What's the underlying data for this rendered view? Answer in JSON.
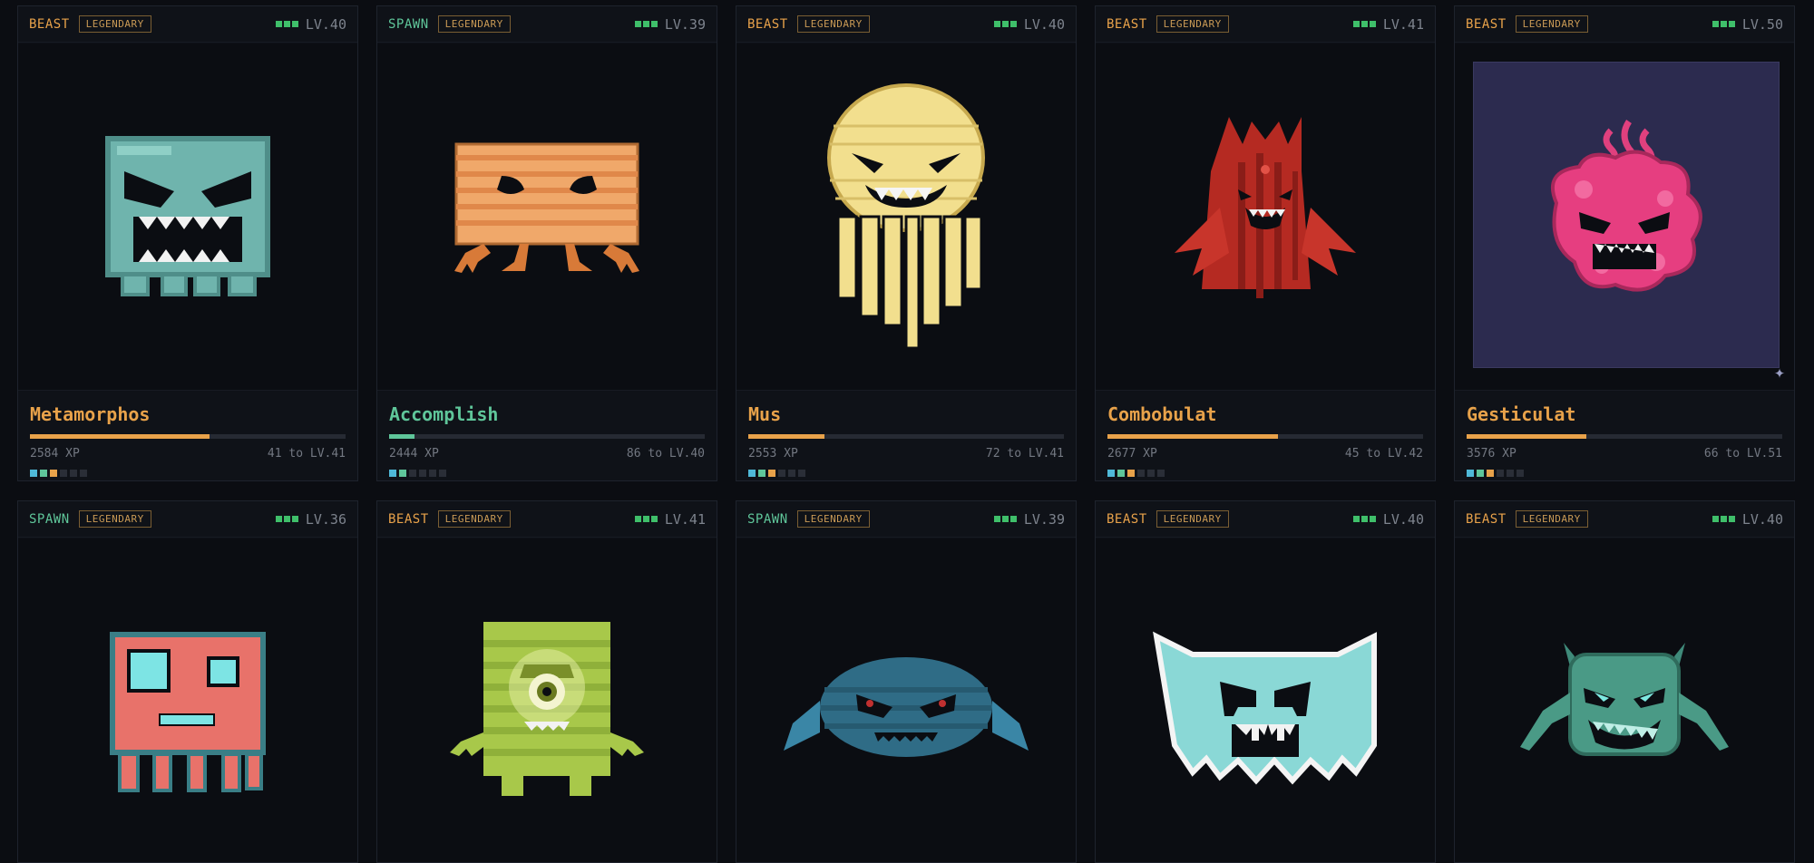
{
  "cards": [
    {
      "kind": "BEAST",
      "rarity": "LEGENDARY",
      "level": "LV.40",
      "name": "Metamorphos",
      "xp": "2584 XP",
      "next": "41 to LV.41",
      "progress": 0.57,
      "dots": [
        "c1",
        "c2",
        "c3",
        "",
        "",
        ""
      ],
      "creature": "teal-block-monster"
    },
    {
      "kind": "SPAWN",
      "rarity": "LEGENDARY",
      "level": "LV.39",
      "name": "Accomplish",
      "xp": "2444 XP",
      "next": "86 to LV.40",
      "progress": 0.08,
      "dots": [
        "c1",
        "c2",
        "",
        "",
        "",
        ""
      ],
      "creature": "orange-box-crab"
    },
    {
      "kind": "BEAST",
      "rarity": "LEGENDARY",
      "level": "LV.40",
      "name": "Mus",
      "xp": "2553 XP",
      "next": "72 to LV.41",
      "progress": 0.24,
      "dots": [
        "c1",
        "c2",
        "c3",
        "",
        "",
        ""
      ],
      "creature": "yellow-jellyfish"
    },
    {
      "kind": "BEAST",
      "rarity": "LEGENDARY",
      "level": "LV.41",
      "name": "Combobulat",
      "xp": "2677 XP",
      "next": "45 to LV.42",
      "progress": 0.54,
      "dots": [
        "c1",
        "c2",
        "c3",
        "",
        "",
        ""
      ],
      "creature": "red-bat-demon"
    },
    {
      "kind": "BEAST",
      "rarity": "LEGENDARY",
      "level": "LV.50",
      "name": "Gesticulat",
      "xp": "3576 XP",
      "next": "66 to LV.51",
      "progress": 0.38,
      "dots": [
        "c1",
        "c2",
        "c3",
        "",
        "",
        ""
      ],
      "creature": "pink-blob-monster",
      "framed": true
    }
  ],
  "cards_row2": [
    {
      "kind": "SPAWN",
      "rarity": "LEGENDARY",
      "level": "LV.36",
      "creature": "coral-box-squid"
    },
    {
      "kind": "BEAST",
      "rarity": "LEGENDARY",
      "level": "LV.41",
      "creature": "green-cyclops-cube"
    },
    {
      "kind": "SPAWN",
      "rarity": "LEGENDARY",
      "level": "LV.39",
      "creature": "blue-round-bat"
    },
    {
      "kind": "BEAST",
      "rarity": "LEGENDARY",
      "level": "LV.40",
      "creature": "cyan-ghost-cup"
    },
    {
      "kind": "BEAST",
      "rarity": "LEGENDARY",
      "level": "LV.40",
      "creature": "teal-horned-spider"
    }
  ],
  "colors": {
    "beast": "#e8a24a",
    "spawn": "#5fc69a",
    "level_pips": "#3fbf6a",
    "background": "#0b0d12"
  }
}
